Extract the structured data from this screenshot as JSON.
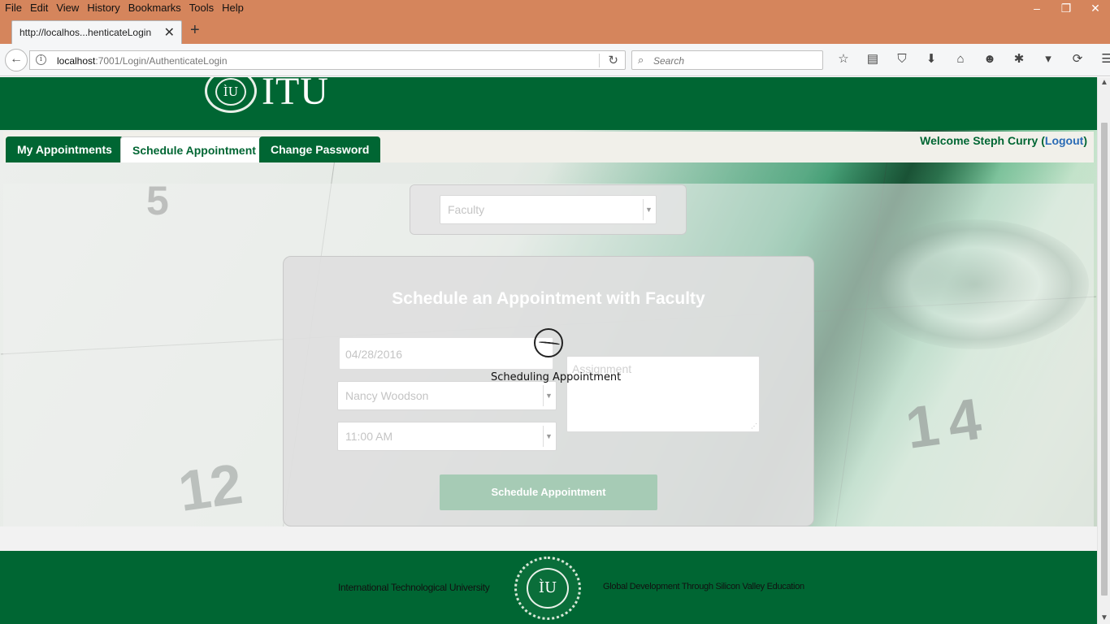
{
  "browser": {
    "menu": [
      "File",
      "Edit",
      "View",
      "History",
      "Bookmarks",
      "Tools",
      "Help"
    ],
    "window_controls": {
      "minimize": "–",
      "restore": "❐",
      "close": "✕"
    },
    "tab_title": "http://localhos...henticateLogin",
    "new_tab": "+",
    "url_host": "localhost",
    "url_rest": ":7001/Login/AuthenticateLogin",
    "search_placeholder": "Search",
    "toolbar_icons": [
      "bookmark-star-icon",
      "reading-list-icon",
      "pocket-icon",
      "download-icon",
      "home-icon",
      "hello-icon",
      "extension-icon",
      "overflow-chevron-icon",
      "sync-icon",
      "menu-icon"
    ]
  },
  "site": {
    "logo_text": "ITU",
    "tabs": [
      {
        "label": "My Appointments",
        "active": false
      },
      {
        "label": "Schedule Appointment",
        "active": true
      },
      {
        "label": "Change Password",
        "active": false
      }
    ],
    "welcome_prefix": "Welcome Steph Curry (",
    "logout_label": "Logout",
    "welcome_suffix": ")",
    "background_numbers": {
      "left": "12",
      "right": "14",
      "top": "5"
    }
  },
  "form": {
    "faculty_select_value": "Faculty",
    "title": "Schedule an Appointment with Faculty",
    "date_value": "04/28/2016",
    "professor_select_value": "Nancy Woodson",
    "time_select_value": "11:00 AM",
    "assignment_placeholder": "Assignment",
    "submit_label": "Schedule Appointment"
  },
  "loading": {
    "label": "Scheduling Appointment"
  },
  "footer": {
    "left_text": "International Technological University",
    "right_text": "Global Development Through Silicon Valley Education"
  },
  "colors": {
    "brand_green": "#006633",
    "browser_chrome": "#d5855c",
    "logout_link": "#2a6bb5",
    "disabled_button": "#a6cbb5"
  }
}
